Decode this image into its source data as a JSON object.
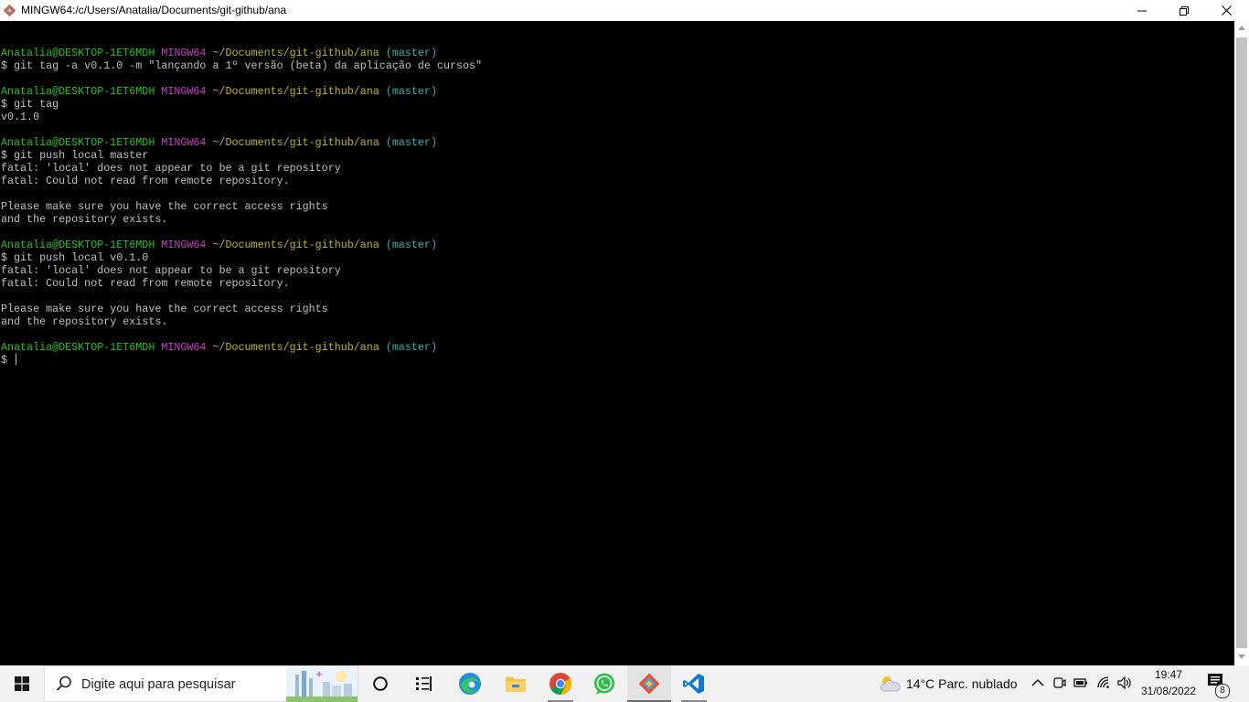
{
  "window": {
    "title": "MINGW64:/c/Users/Anatalia/Documents/git-github/ana",
    "controls": {
      "minimize": "—",
      "maximize": "❐",
      "close": "✕"
    }
  },
  "terminal": {
    "prompt": {
      "user_host": "Anatalia@DESKTOP-1ET6MDH",
      "env": "MINGW64",
      "path": "~/Documents/git-github/ana",
      "branch": "(master)"
    },
    "lines": [
      {
        "text": ""
      },
      {
        "kind": "prompt"
      },
      {
        "text": "$ git tag -a v0.1.0 -m \"lançando a 1º versão (beta) da aplicação de cursos\""
      },
      {
        "text": ""
      },
      {
        "kind": "prompt"
      },
      {
        "text": "$ git tag"
      },
      {
        "text": "v0.1.0"
      },
      {
        "text": ""
      },
      {
        "kind": "prompt"
      },
      {
        "text": "$ git push local master"
      },
      {
        "text": "fatal: 'local' does not appear to be a git repository"
      },
      {
        "text": "fatal: Could not read from remote repository."
      },
      {
        "text": ""
      },
      {
        "text": "Please make sure you have the correct access rights"
      },
      {
        "text": "and the repository exists."
      },
      {
        "text": ""
      },
      {
        "kind": "prompt"
      },
      {
        "text": "$ git push local v0.1.0"
      },
      {
        "text": "fatal: 'local' does not appear to be a git repository"
      },
      {
        "text": "fatal: Could not read from remote repository."
      },
      {
        "text": ""
      },
      {
        "text": "Please make sure you have the correct access rights"
      },
      {
        "text": "and the repository exists."
      },
      {
        "text": ""
      },
      {
        "kind": "prompt"
      },
      {
        "text": "$ ",
        "cursor": true
      }
    ],
    "colors": {
      "background": "#000000",
      "text": "#c0c0c0",
      "user_host": "#1cc61c",
      "env": "#c640c6",
      "path": "#c1b41f",
      "branch": "#2ab1b6"
    }
  },
  "taskbar": {
    "search_placeholder": "Digite aqui para pesquisar",
    "apps": [
      {
        "name": "task-view",
        "icon": "task-view-icon"
      },
      {
        "name": "widgets",
        "icon": "widgets-icon"
      },
      {
        "name": "edge",
        "icon": "edge-icon"
      },
      {
        "name": "file-explorer",
        "icon": "folder-icon"
      },
      {
        "name": "chrome",
        "icon": "chrome-icon"
      },
      {
        "name": "whatsapp",
        "icon": "whatsapp-icon"
      },
      {
        "name": "git-bash",
        "icon": "git-icon",
        "active": true
      },
      {
        "name": "vscode",
        "icon": "vscode-icon"
      }
    ],
    "tray": {
      "weather": "14°C  Parc. nublado",
      "time": "19:47",
      "date": "31/08/2022",
      "notifications": "8"
    }
  }
}
